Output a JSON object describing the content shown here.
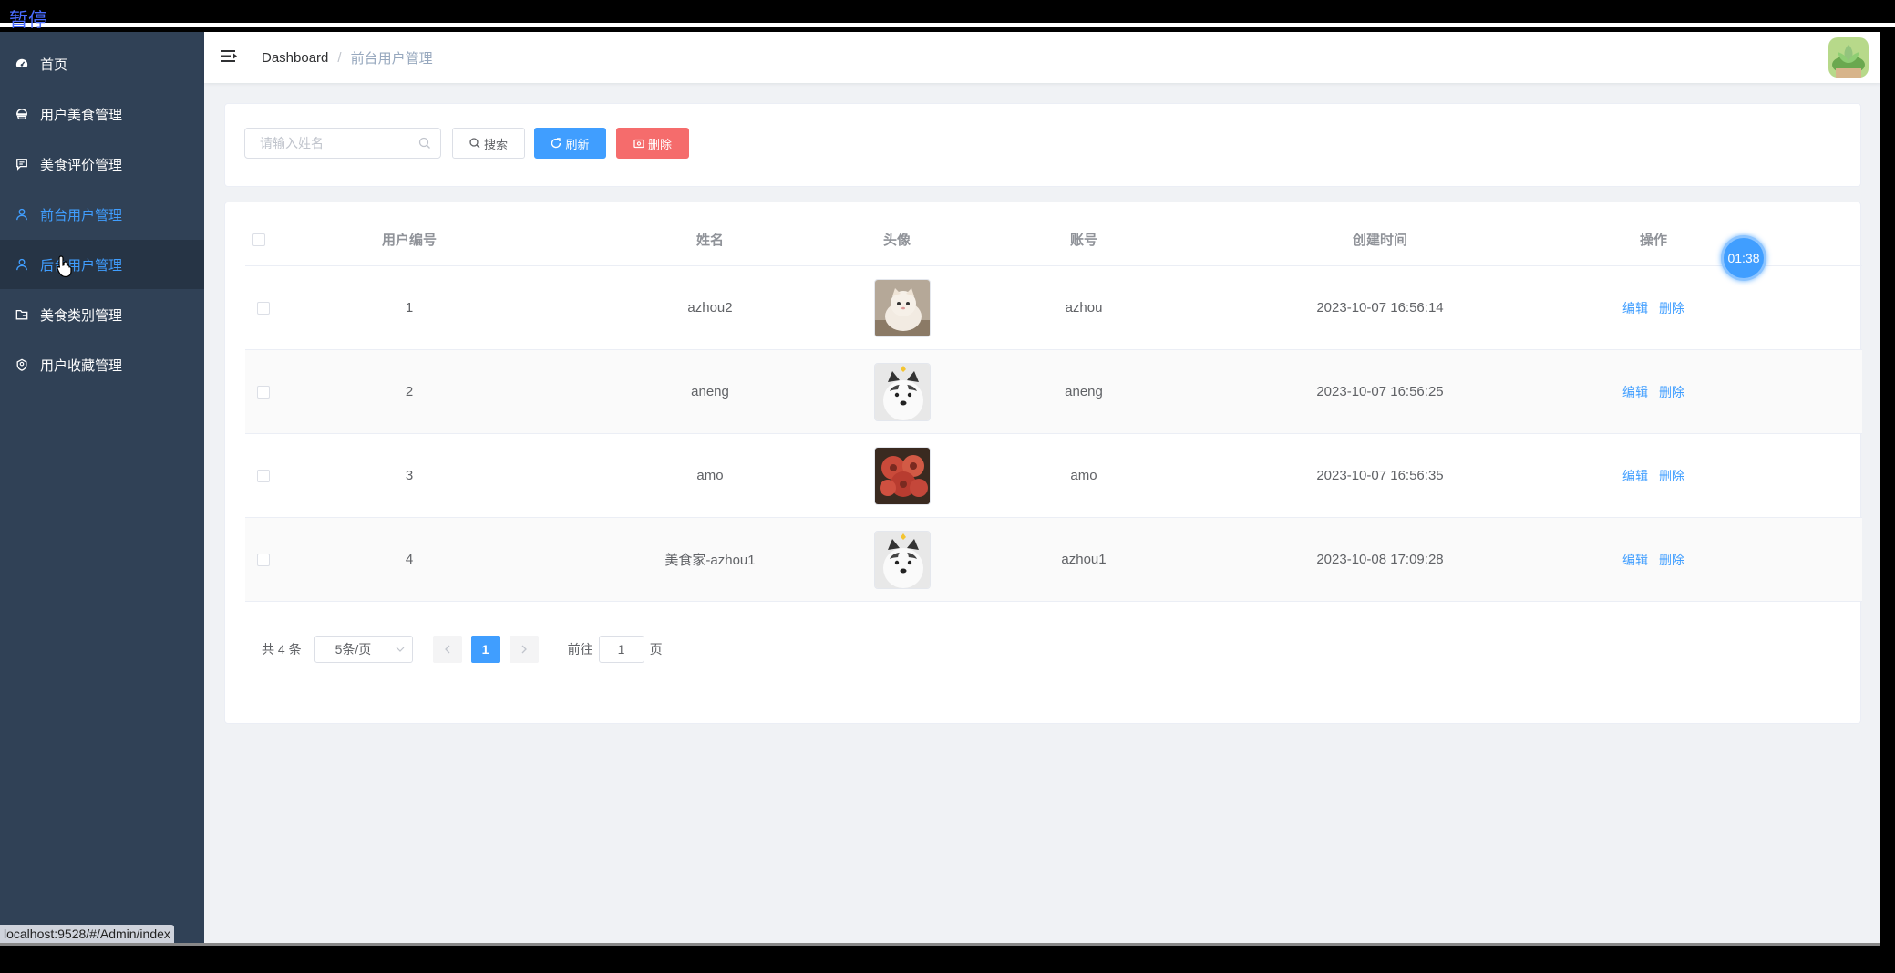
{
  "overlay": {
    "paused_label": "暂停",
    "timer": "01:38",
    "status_url": "localhost:9528/#/Admin/index"
  },
  "sidebar": {
    "items": [
      {
        "label": "首页",
        "icon": "dashboard-icon",
        "state": "normal"
      },
      {
        "label": "用户美食管理",
        "icon": "food-icon",
        "state": "normal"
      },
      {
        "label": "美食评价管理",
        "icon": "comment-icon",
        "state": "normal"
      },
      {
        "label": "前台用户管理",
        "icon": "user-icon",
        "state": "active"
      },
      {
        "label": "后台用户管理",
        "icon": "user-icon",
        "state": "hover"
      },
      {
        "label": "美食类别管理",
        "icon": "folder-icon",
        "state": "normal"
      },
      {
        "label": "用户收藏管理",
        "icon": "favorite-icon",
        "state": "normal"
      }
    ]
  },
  "navbar": {
    "breadcrumb_root": "Dashboard",
    "breadcrumb_sep": "/",
    "breadcrumb_current": "前台用户管理"
  },
  "search": {
    "placeholder": "请输入姓名",
    "search_label": "搜索",
    "refresh_label": "刷新",
    "delete_label": "删除"
  },
  "table": {
    "headers": {
      "id": "用户编号",
      "name": "姓名",
      "avatar": "头像",
      "account": "账号",
      "created": "创建时间",
      "ops": "操作"
    },
    "rows": [
      {
        "id": "1",
        "name": "azhou2",
        "avatar": "cat-photo",
        "account": "azhou",
        "created": "2023-10-07 16:56:14"
      },
      {
        "id": "2",
        "name": "aneng",
        "avatar": "husky-photo",
        "account": "aneng",
        "created": "2023-10-07 16:56:25"
      },
      {
        "id": "3",
        "name": "amo",
        "avatar": "succulent-photo",
        "account": "amo",
        "created": "2023-10-07 16:56:35"
      },
      {
        "id": "4",
        "name": "美食家-azhou1",
        "avatar": "husky-photo",
        "account": "azhou1",
        "created": "2023-10-08 17:09:28"
      }
    ],
    "edit_label": "编辑",
    "delete_label": "删除"
  },
  "pagination": {
    "total": "共 4 条",
    "page_size": "5条/页",
    "current_page": "1",
    "goto_prefix": "前往",
    "goto_value": "1",
    "goto_suffix": "页"
  },
  "colors": {
    "sidebar_bg": "#304156",
    "accent": "#409eff",
    "danger": "#f56c6c"
  }
}
